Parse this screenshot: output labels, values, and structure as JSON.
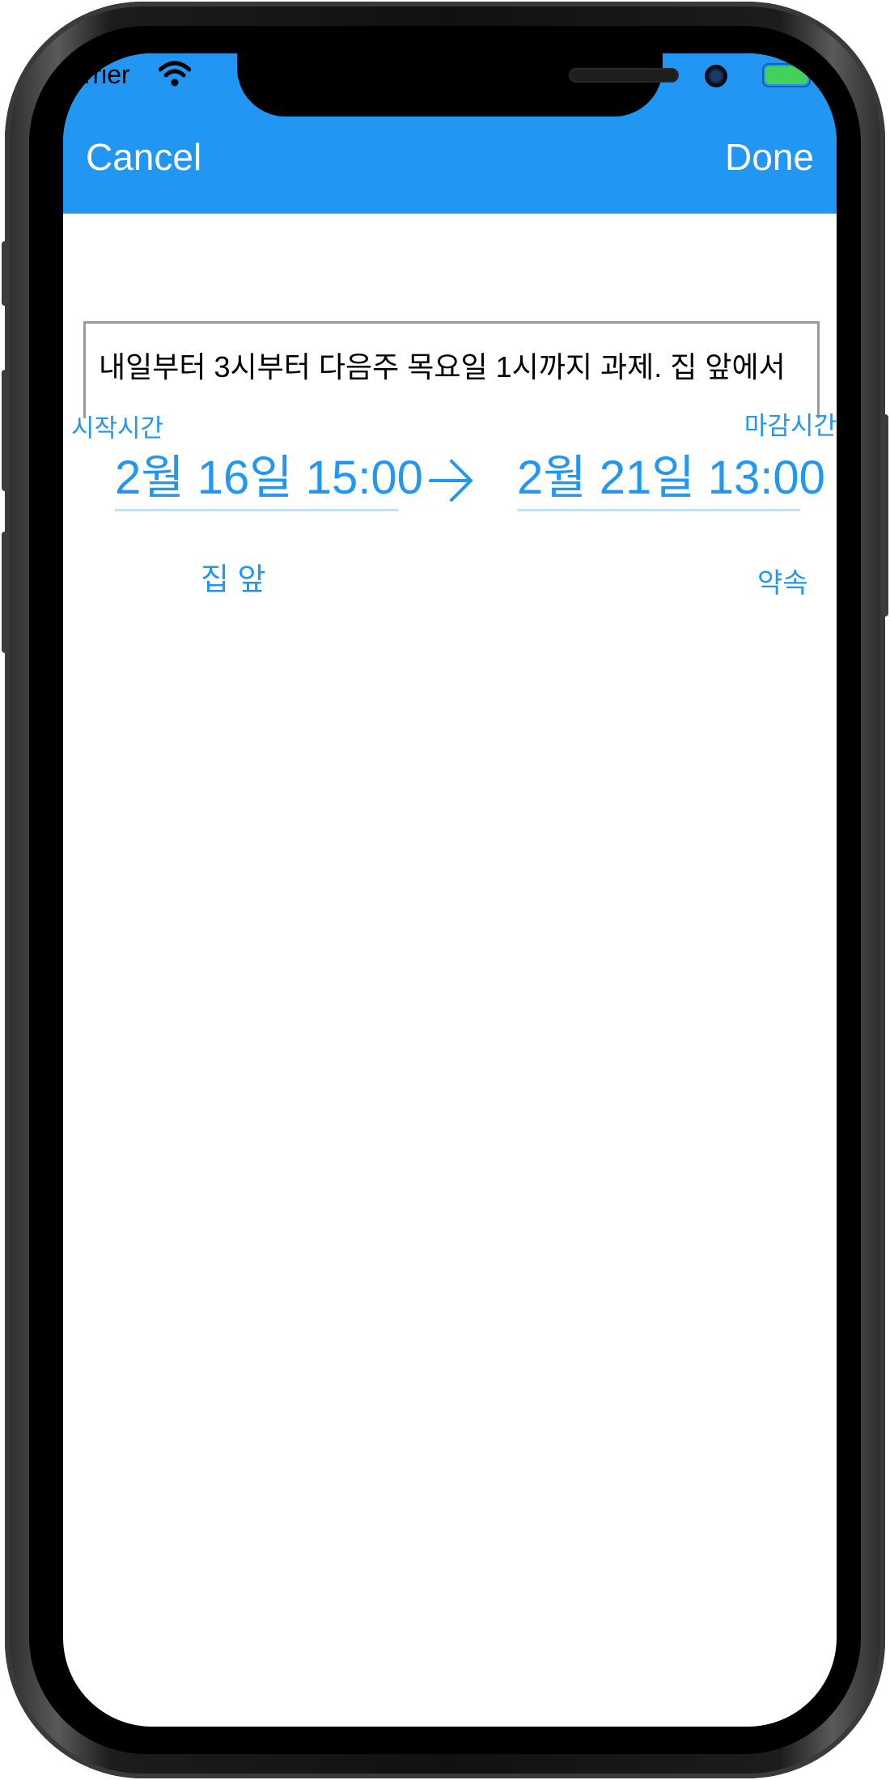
{
  "status_bar": {
    "carrier": "arrier",
    "wifi_icon": "wifi-icon",
    "battery_icon": "battery-icon",
    "battery_color": "#43d15c"
  },
  "nav_bar": {
    "background_color": "#2196f3",
    "cancel_label": "Cancel",
    "done_label": "Done"
  },
  "input": {
    "value": "내일부터 3시부터 다음주 목요일 1시까지 과제. 집 앞에서"
  },
  "schedule": {
    "start_label": "시작시간",
    "end_label": "마감시간",
    "start_value": "2월 16일 15:00",
    "end_value": "2월 21일 13:00",
    "arrow_icon": "arrow-right-icon",
    "accent_color": "#2196f3"
  },
  "tags": {
    "location": "집 앞",
    "category": "약속"
  }
}
